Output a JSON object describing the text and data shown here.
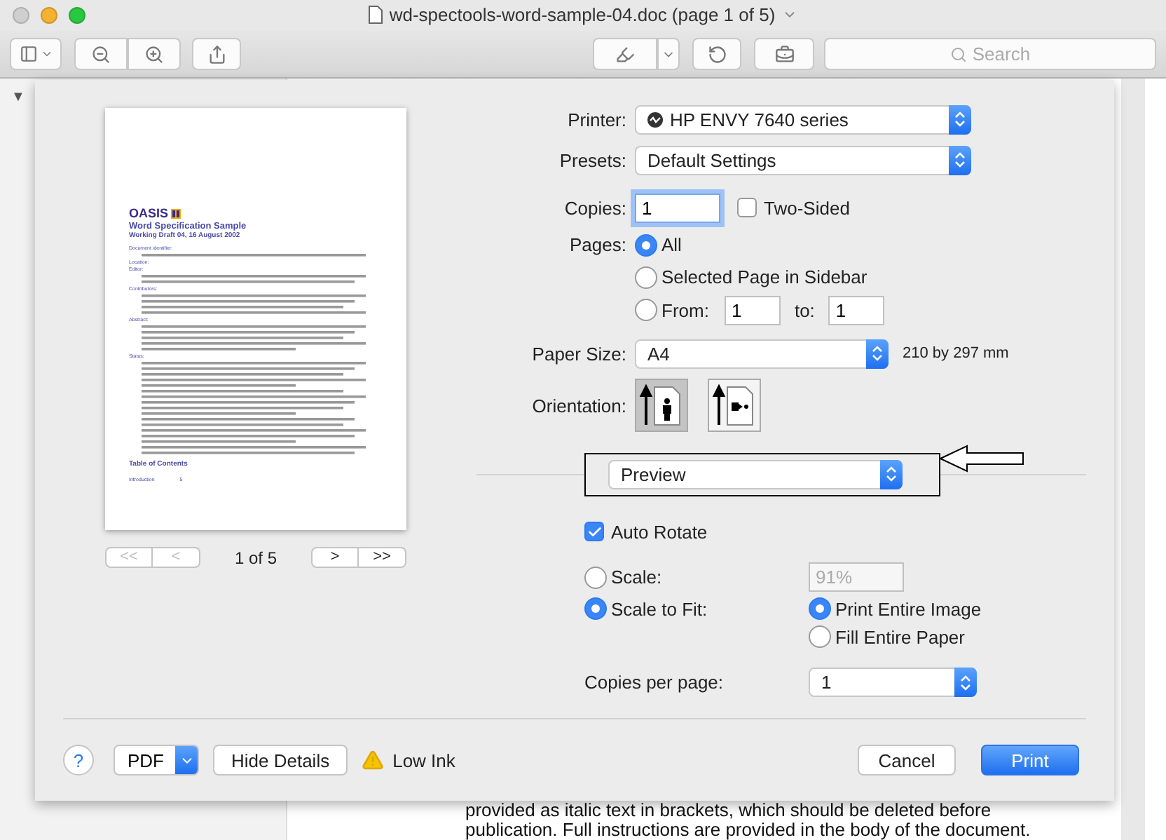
{
  "window": {
    "title": "wd-spectools-word-sample-04.doc (page 1 of 5)"
  },
  "toolbar": {
    "search": {
      "placeholder": "Search"
    }
  },
  "sidebar": {
    "toggle": "▼"
  },
  "document": {
    "lines": [
      "provided as italic text in brackets, which should be deleted before",
      "publication. Full instructions are provided in the body of the document."
    ]
  },
  "print_dialog": {
    "preview": {
      "logo": "OASIS",
      "title": "Word Specification Sample",
      "subtitle": "Working Draft 04, 16 August 2002",
      "sections": [
        {
          "heading": "Document identifier:"
        },
        {
          "heading": "Location:"
        },
        {
          "heading": "Editor:"
        },
        {
          "heading": "Contributors:"
        },
        {
          "heading": "Abstract:"
        },
        {
          "heading": "Status:"
        }
      ],
      "toc_heading": "Table of Contents",
      "toc_item": "Introduction",
      "toc_page": "5"
    },
    "nav": [
      {
        "label": "<<",
        "disabled": true
      },
      {
        "label": "<",
        "disabled": true
      },
      {
        "label": ">",
        "disabled": false
      },
      {
        "label": ">>",
        "disabled": false
      }
    ],
    "page_indicator": "1 of 5",
    "printer": {
      "label": "Printer:",
      "value": "HP ENVY 7640 series"
    },
    "presets": {
      "label": "Presets:",
      "value": "Default Settings"
    },
    "copies": {
      "label": "Copies:",
      "value": "1",
      "two_sided": {
        "label": "Two-Sided",
        "checked": false
      }
    },
    "pages": {
      "label": "Pages:",
      "options": [
        {
          "label": "All",
          "selected": true
        },
        {
          "label": "Selected Page in Sidebar",
          "selected": false
        },
        {
          "label": "From:",
          "selected": false
        }
      ],
      "from": "1",
      "to_label": "to:",
      "to": "1"
    },
    "paper_size": {
      "label": "Paper Size:",
      "value": "A4",
      "dimensions": "210 by 297 mm"
    },
    "orientation": {
      "label": "Orientation:",
      "options": [
        {
          "kind": "portrait",
          "selected": true
        },
        {
          "kind": "landscape",
          "selected": false
        }
      ]
    },
    "section_menu": {
      "value": "Preview"
    },
    "auto_rotate": {
      "label": "Auto Rotate",
      "checked": true
    },
    "scale": {
      "options": [
        {
          "label": "Scale:",
          "selected": false
        },
        {
          "label": "Scale to Fit:",
          "selected": true
        }
      ],
      "value": "91%",
      "disabled": true
    },
    "fit": [
      {
        "label": "Print Entire Image",
        "selected": true
      },
      {
        "label": "Fill Entire Paper",
        "selected": false
      }
    ],
    "copies_per_page": {
      "label": "Copies per page:",
      "value": "1"
    },
    "footer": {
      "help": "?",
      "pdf": "PDF",
      "hide_details": "Hide Details",
      "warning": "Low Ink",
      "cancel": "Cancel",
      "print": "Print"
    }
  }
}
